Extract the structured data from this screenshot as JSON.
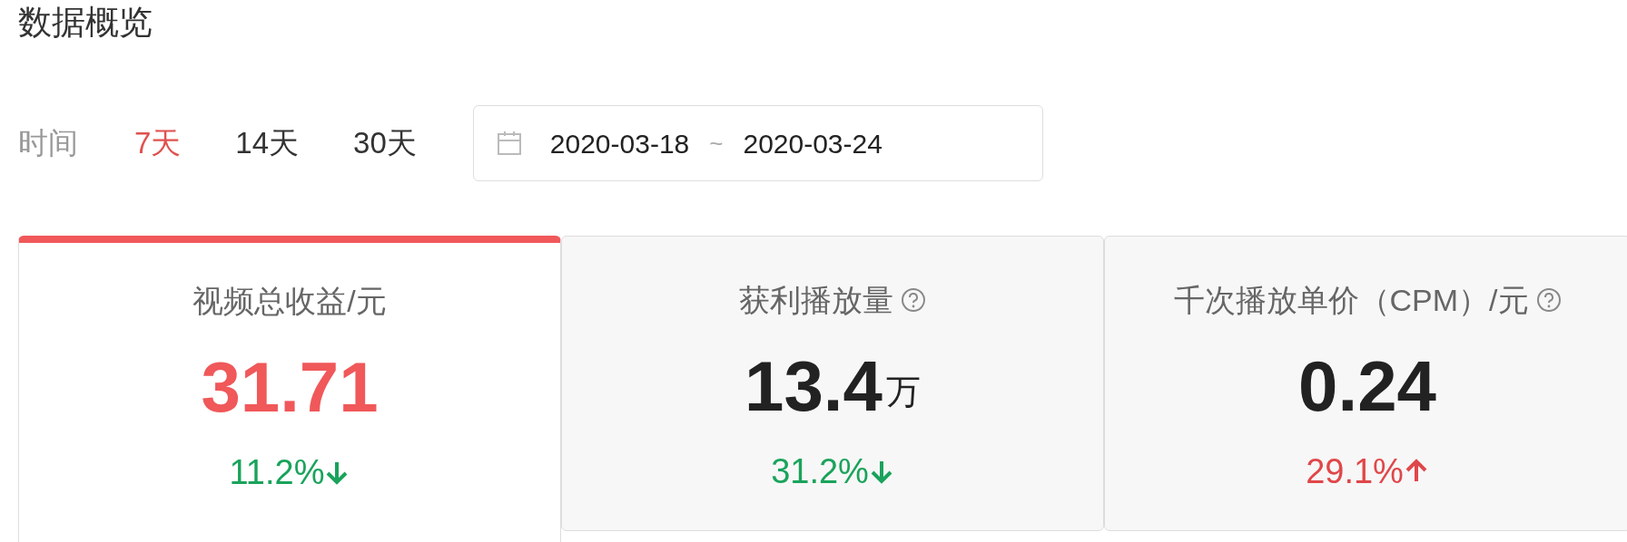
{
  "title": "数据概览",
  "time_filter": {
    "label": "时间",
    "options": [
      {
        "label": "7天",
        "selected": true
      },
      {
        "label": "14天",
        "selected": false
      },
      {
        "label": "30天",
        "selected": false
      }
    ]
  },
  "date_range": {
    "start": "2020-03-18",
    "separator": "~",
    "end": "2020-03-24"
  },
  "cards": [
    {
      "title": "视频总收益/元",
      "help": false,
      "value": "31.71",
      "change": "11.2%",
      "kind": "down",
      "selected": true
    },
    {
      "title": "获利播放量",
      "help": true,
      "value": "13.4",
      "unit": "万",
      "change": "31.2%",
      "kind": "down",
      "selected": false
    },
    {
      "title": "千次播放单价（CPM）/元",
      "help": true,
      "value": "0.24",
      "change": "29.1%",
      "kind": "up",
      "selected": false
    }
  ]
}
